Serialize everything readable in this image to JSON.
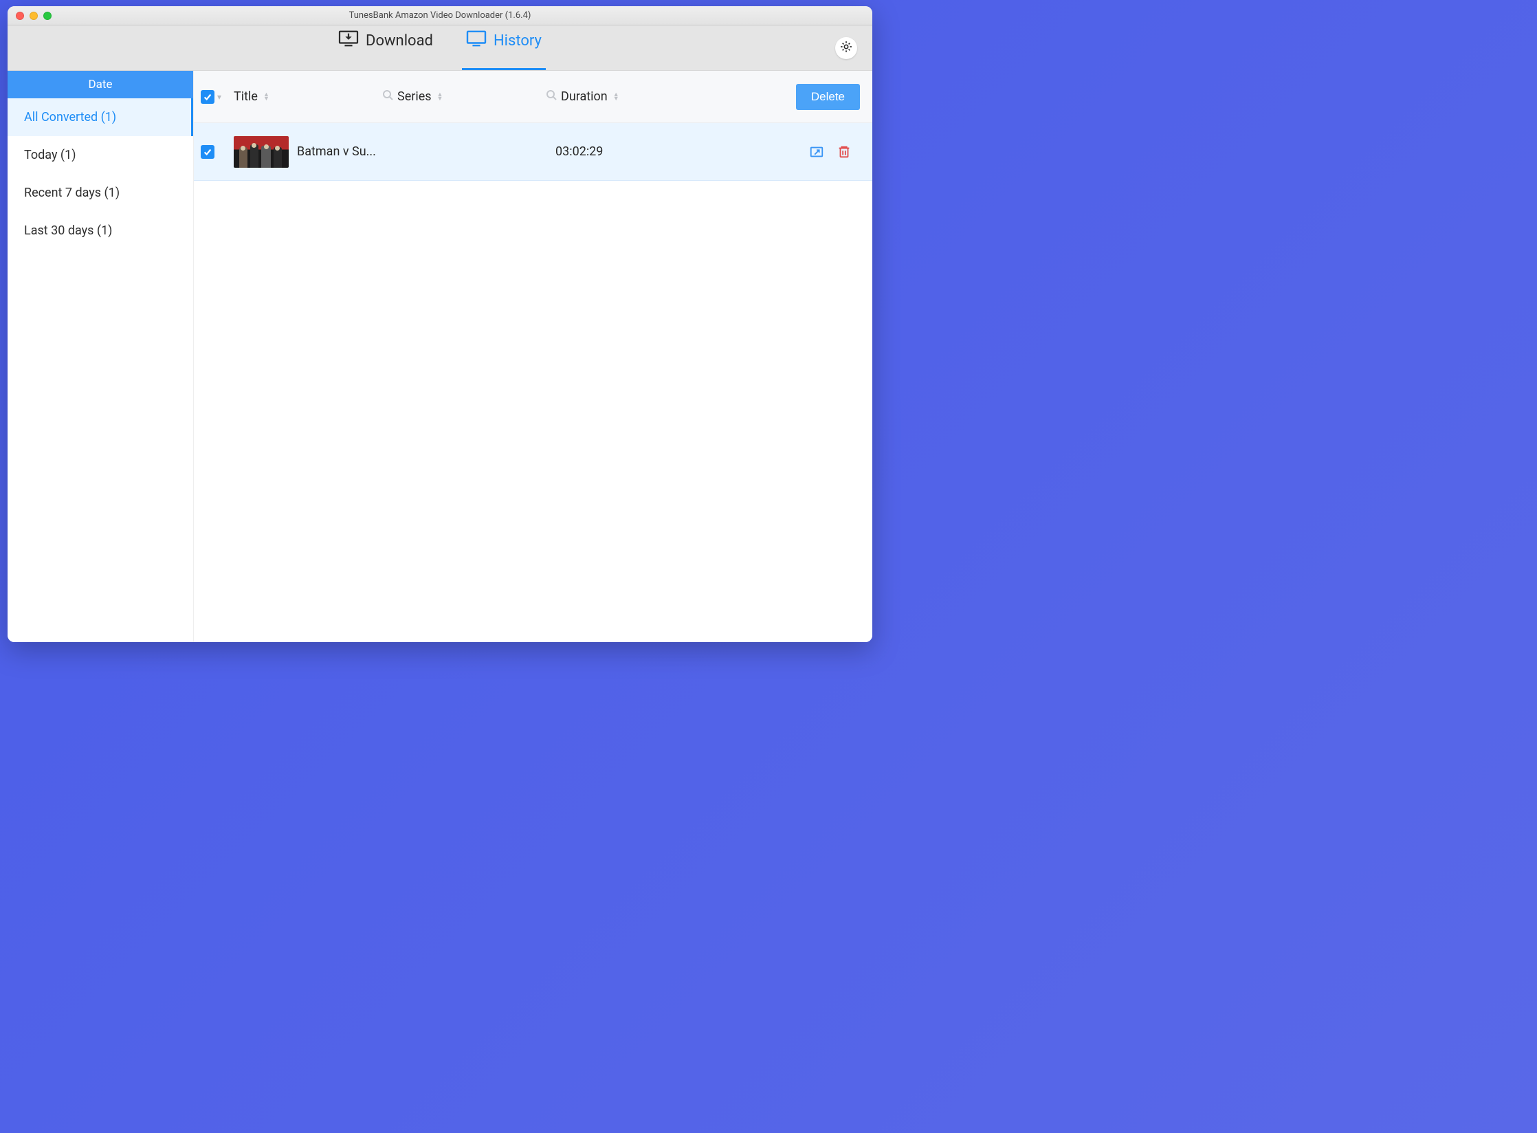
{
  "window": {
    "title": "TunesBank Amazon Video Downloader (1.6.4)"
  },
  "tabs": {
    "download": "Download",
    "history": "History"
  },
  "sidebar": {
    "header": "Date",
    "items": [
      {
        "label": "All Converted (1)",
        "selected": true
      },
      {
        "label": "Today (1)",
        "selected": false
      },
      {
        "label": "Recent 7 days (1)",
        "selected": false
      },
      {
        "label": "Last 30 days (1)",
        "selected": false
      }
    ]
  },
  "columns": {
    "title": "Title",
    "series": "Series",
    "duration": "Duration",
    "delete_label": "Delete"
  },
  "rows": [
    {
      "title": "Batman v Su...",
      "series": "",
      "duration": "03:02:29",
      "checked": true
    }
  ]
}
